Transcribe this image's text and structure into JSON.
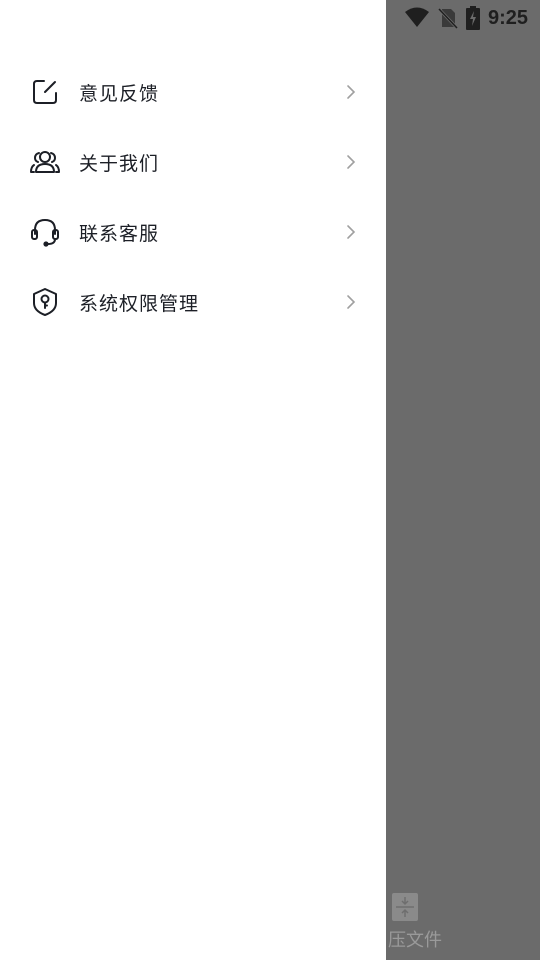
{
  "status_bar": {
    "time": "9:25",
    "icons": [
      "wifi-icon",
      "no-sim-icon",
      "battery-charging-icon"
    ]
  },
  "drawer": {
    "menu_items": [
      {
        "label": "意见反馈",
        "icon": "edit-icon"
      },
      {
        "label": "关于我们",
        "icon": "users-icon"
      },
      {
        "label": "联系客服",
        "icon": "headset-icon"
      },
      {
        "label": "系统权限管理",
        "icon": "shield-key-icon"
      }
    ]
  },
  "background": {
    "tab_label": "压文件",
    "tab_icon": "compress-icon"
  },
  "colors": {
    "scrim": "#6b6b6b",
    "drawer_bg": "#ffffff",
    "text": "#1c1f26",
    "chevron": "#a0a0a0"
  }
}
